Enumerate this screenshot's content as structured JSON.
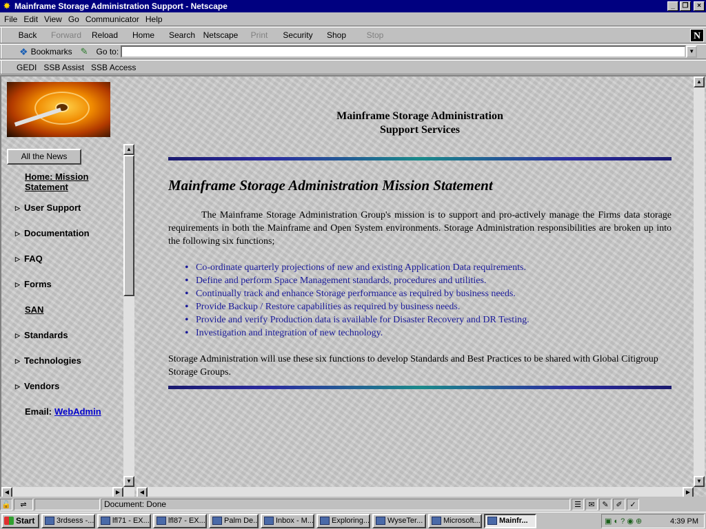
{
  "window": {
    "title": "Mainframe Storage Administration Support - Netscape",
    "controls": [
      "_",
      "❒",
      "×"
    ]
  },
  "menu": [
    "File",
    "Edit",
    "View",
    "Go",
    "Communicator",
    "Help"
  ],
  "nav_toolbar": {
    "buttons": [
      {
        "label": "Back",
        "enabled": true
      },
      {
        "label": "Forward",
        "enabled": false
      },
      {
        "label": "Reload",
        "enabled": true
      },
      {
        "label": "Home",
        "enabled": true
      },
      {
        "label": "Search",
        "enabled": true
      },
      {
        "label": "Netscape",
        "enabled": true
      },
      {
        "label": "Print",
        "enabled": false
      },
      {
        "label": "Security",
        "enabled": true
      },
      {
        "label": "Shop",
        "enabled": true
      },
      {
        "label": "Stop",
        "enabled": false
      }
    ],
    "logo": "N"
  },
  "location": {
    "bookmarks_label": "Bookmarks",
    "goto_label": "Go to:",
    "value": ""
  },
  "personal_toolbar": [
    "GEDI",
    "SSB Assist",
    "SSB Access"
  ],
  "sidebar": {
    "news_button": "All the News",
    "items": [
      {
        "label": "Home: Mission Statement",
        "style": "visited"
      },
      {
        "label": "User Support",
        "style": "folder"
      },
      {
        "label": "Documentation",
        "style": "folder"
      },
      {
        "label": "FAQ",
        "style": "folder"
      },
      {
        "label": "Forms",
        "style": "folder"
      },
      {
        "label": "SAN",
        "style": "link"
      },
      {
        "label": "Standards",
        "style": "folder"
      },
      {
        "label": "Technologies",
        "style": "folder"
      },
      {
        "label": "Vendors",
        "style": "folder"
      }
    ],
    "email_label": "Email:",
    "email_link": "WebAdmin"
  },
  "content": {
    "heading_line1": "Mainframe Storage Administration",
    "heading_line2": "Support Services",
    "mission_title": "Mainframe Storage Administration Mission Statement",
    "intro": "The Mainframe Storage Administration Group's mission is to support and pro-actively manage the Firms data storage requirements in both the Mainframe and Open System environments. Storage Administration responsibilities are broken up into the following six functions;",
    "functions": [
      "Co-ordinate quarterly projections of new and existing Application Data requirements.",
      "Define and perform Space Management standards, procedures and utilities.",
      "Continually track and enhance Storage performance as required by business needs.",
      "Provide Backup / Restore capabilities as required by business needs.",
      "Provide and verify Production data is available for Disaster Recovery and DR Testing.",
      "Investigation and integration of new technology."
    ],
    "closing": "Storage Administration will use these six functions to develop Standards and Best Practices to be shared with Global Citigroup Storage Groups."
  },
  "status": {
    "text": "Document: Done"
  },
  "taskbar": {
    "start_label": "Start",
    "tasks": [
      {
        "label": "3rdsess -...",
        "active": false
      },
      {
        "label": "lfl71 - EX...",
        "active": false
      },
      {
        "label": "lfl87 - EX...",
        "active": false
      },
      {
        "label": "Palm De...",
        "active": false
      },
      {
        "label": "Inbox - M...",
        "active": false
      },
      {
        "label": "Exploring...",
        "active": false
      },
      {
        "label": "WyseTer...",
        "active": false
      },
      {
        "label": "Microsoft...",
        "active": false
      },
      {
        "label": "Mainfr...",
        "active": true
      }
    ],
    "clock": "4:39 PM"
  }
}
